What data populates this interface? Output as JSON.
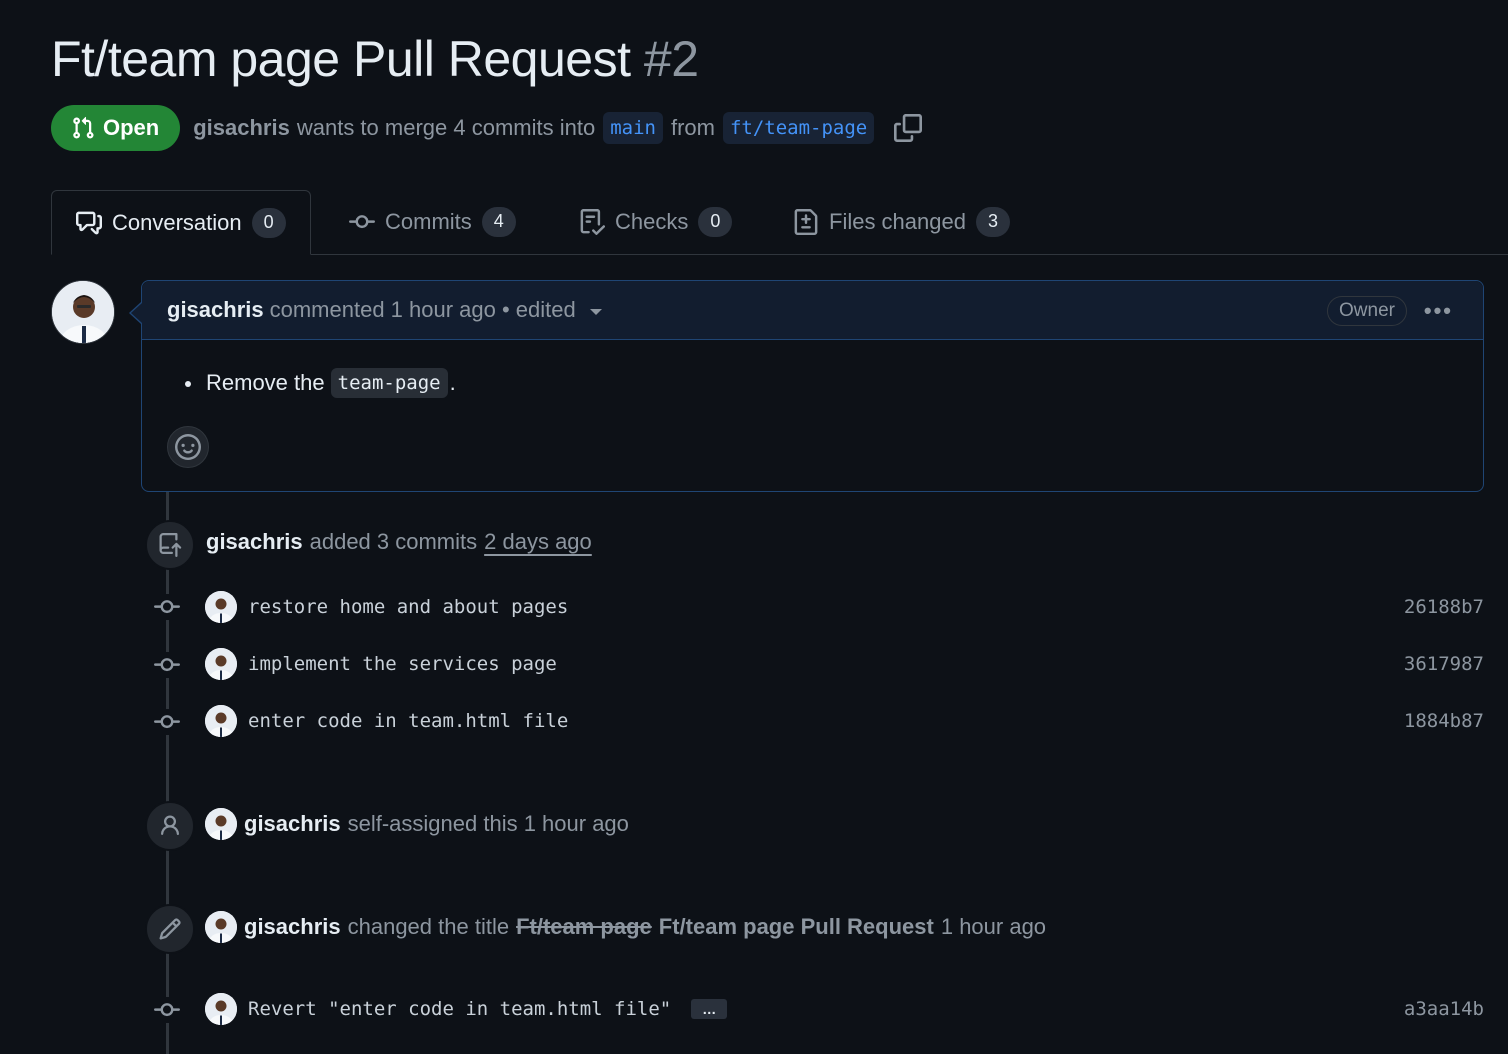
{
  "pr": {
    "title": "Ft/team page Pull Request",
    "number": "#2",
    "state": "Open",
    "author": "gisachris",
    "merge_text": "wants to merge 4 commits into",
    "base_branch": "main",
    "from_text": "from",
    "head_branch": "ft/team-page"
  },
  "tabs": [
    {
      "label": "Conversation",
      "count": "0",
      "icon": "comment-discussion-icon"
    },
    {
      "label": "Commits",
      "count": "4",
      "icon": "git-commit-icon"
    },
    {
      "label": "Checks",
      "count": "0",
      "icon": "checklist-icon"
    },
    {
      "label": "Files changed",
      "count": "3",
      "icon": "file-diff-icon"
    }
  ],
  "comment": {
    "author": "gisachris",
    "meta": "commented 1 hour ago • edited",
    "role": "Owner",
    "body_prefix": "Remove the",
    "body_code": "team-page",
    "body_suffix": "."
  },
  "timeline": {
    "added": {
      "author": "gisachris",
      "text": "added 3 commits",
      "time": "2 days ago"
    },
    "commits": [
      {
        "message": "restore home and about pages",
        "sha": "26188b7"
      },
      {
        "message": "implement the services page",
        "sha": "3617987"
      },
      {
        "message": "enter code in team.html file",
        "sha": "1884b87"
      }
    ],
    "assigned": {
      "author": "gisachris",
      "text": "self-assigned this 1 hour ago"
    },
    "renamed": {
      "author": "gisachris",
      "text": "changed the title",
      "old_title": "Ft/team page",
      "new_title": "Ft/team page Pull Request",
      "time": "1 hour ago"
    },
    "revert_commit": {
      "message": "Revert \"enter code in team.html file\"",
      "more": "…",
      "sha": "a3aa14b"
    }
  },
  "colors": {
    "accent": "#4493f8",
    "open": "#238636",
    "bg": "#0d1117"
  }
}
